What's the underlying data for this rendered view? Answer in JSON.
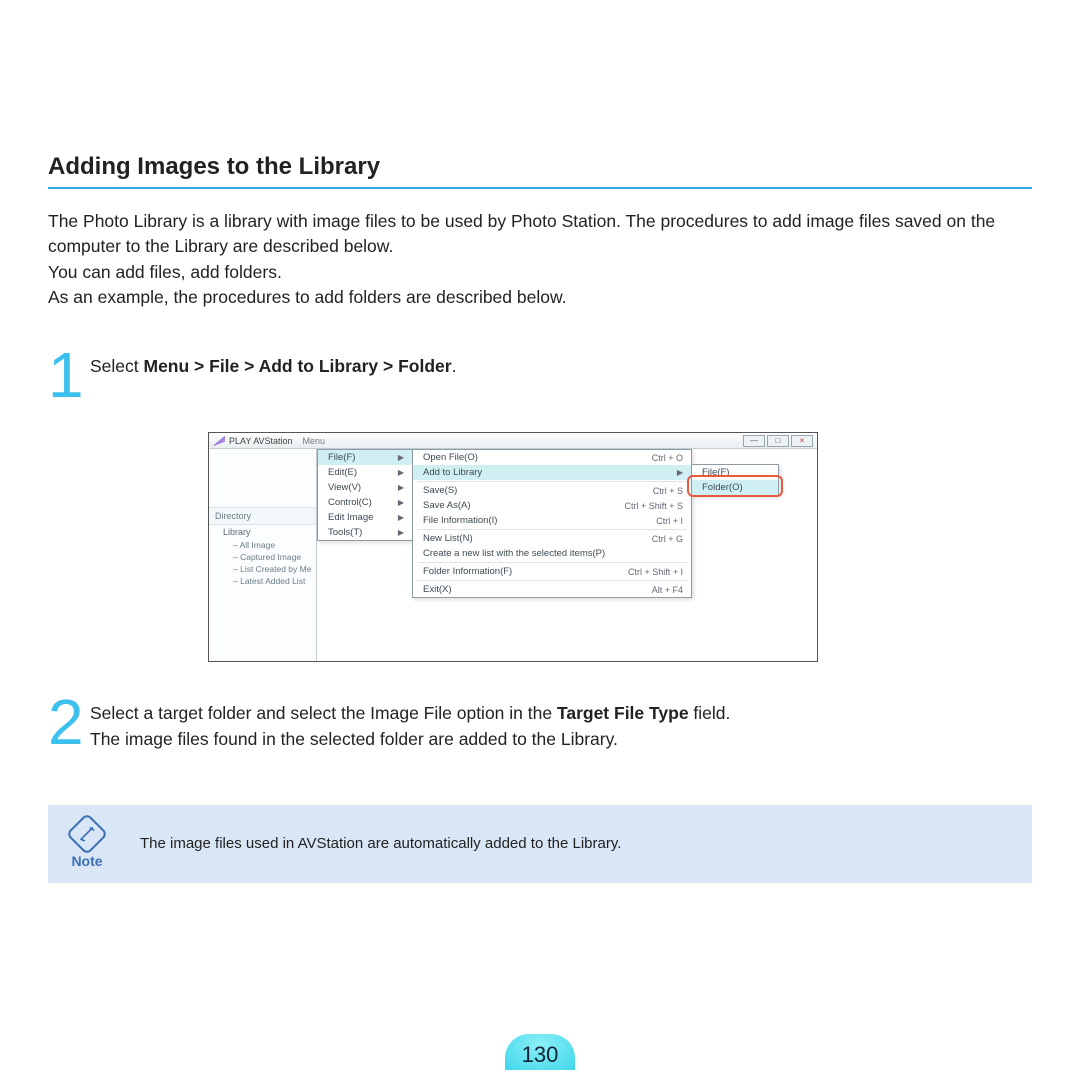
{
  "heading": "Adding Images to the Library",
  "intro": {
    "p1": "The Photo Library is a library with image files to be used by Photo Station. The procedures to add image files saved on the computer to the Library are described below.",
    "p2": "You can add files, add folders.",
    "p3": "As an example, the procedures to add folders are described below."
  },
  "step1": {
    "num": "1",
    "prefix": "Select ",
    "bold": "Menu > File > Add to Library > Folder",
    "suffix": "."
  },
  "step2": {
    "num": "2",
    "line1a": "Select a target folder and select the Image File option in the ",
    "line1b": "Target File Type",
    "line1c": " field.",
    "line2": "The image files found in the selected folder are added to the Library."
  },
  "note": {
    "label": "Note",
    "text": "The image files used in AVStation are automatically added to the Library."
  },
  "page_number": "130",
  "screenshot": {
    "app_title": "PLAY AVStation",
    "menu_label": "Menu",
    "win_buttons": {
      "min": "—",
      "max": "□",
      "close": "×"
    },
    "sidebar": {
      "directory": "Directory",
      "library": "Library",
      "items": [
        "– All Image",
        "– Captured Image",
        "– List Created by Me",
        "– Latest Added List"
      ]
    },
    "menu1": [
      {
        "label": "File(F)",
        "hl": true
      },
      {
        "label": "Edit(E)"
      },
      {
        "label": "View(V)"
      },
      {
        "label": "Control(C)"
      },
      {
        "label": "Edit Image"
      },
      {
        "label": "Tools(T)"
      }
    ],
    "menu2": [
      {
        "label": "Open File(O)",
        "sc": "Ctrl + O"
      },
      {
        "label": "Add to Library",
        "arrow": true,
        "hl": true
      },
      {
        "label": "Save(S)",
        "sc": "Ctrl + S"
      },
      {
        "label": "Save As(A)",
        "sc": "Ctrl + Shift + S"
      },
      {
        "label": "File Information(I)",
        "sc": "Ctrl + I"
      },
      {
        "label": "New List(N)",
        "sc": "Ctrl + G"
      },
      {
        "label": "Create a new list with the selected items(P)"
      },
      {
        "label": "Folder Information(F)",
        "sc": "Ctrl + Shift + I"
      },
      {
        "label": "Exit(X)",
        "sc": "Alt + F4"
      }
    ],
    "menu3": [
      {
        "label": "File(F)"
      },
      {
        "label": "Folder(O)",
        "hl": true
      }
    ]
  }
}
